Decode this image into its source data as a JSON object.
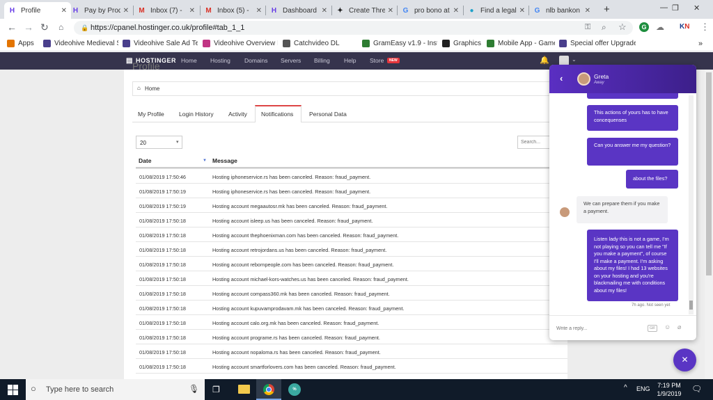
{
  "browser": {
    "tabs": [
      {
        "title": "Profile",
        "fav": "H",
        "color": "#673de6",
        "active": true
      },
      {
        "title": "Pay by Prod",
        "fav": "H",
        "color": "#673de6",
        "active": false
      },
      {
        "title": "Inbox (7) - ",
        "fav": "M",
        "color": "#d93025",
        "active": false
      },
      {
        "title": "Inbox (5) - ",
        "fav": "M",
        "color": "#d93025",
        "active": false
      },
      {
        "title": "Dashboard",
        "fav": "H",
        "color": "#673de6",
        "active": false
      },
      {
        "title": "Create Thre",
        "fav": "✦",
        "color": "#222222",
        "active": false
      },
      {
        "title": "pro bono at",
        "fav": "G",
        "color": "#4285f4",
        "active": false
      },
      {
        "title": "Find a legal",
        "fav": "●",
        "color": "#1da1c9",
        "active": false
      },
      {
        "title": "nlb bankon",
        "fav": "G",
        "color": "#4285f4",
        "active": false
      }
    ],
    "new_tab": "+",
    "window_controls": [
      "—",
      "❐",
      "✕"
    ],
    "url": "https://cpanel.hostinger.co.uk/profile#tab_1_1",
    "bookmarks": [
      {
        "label": "Apps",
        "color": "#e37400"
      },
      {
        "label": "Videohive Medieval S",
        "color": "#4a3f8c"
      },
      {
        "label": "Videohive Sale Ad Te",
        "color": "#4a3f8c"
      },
      {
        "label": "Videohive Overview I",
        "color": "#c13584"
      },
      {
        "label": "Catchvideo DL",
        "color": "#555555"
      },
      {
        "label": "GramEasy v1.9 - Insta",
        "color": "#2e7d32"
      },
      {
        "label": "Graphics",
        "color": "#222222"
      },
      {
        "label": "Mobile App - Game S",
        "color": "#2e7d32"
      },
      {
        "label": "Special offer Upgrade",
        "color": "#4a3f8c"
      }
    ],
    "more": "»"
  },
  "hostinger": {
    "logo": "HOSTINGER",
    "nav": [
      "Home",
      "Hosting",
      "Domains",
      "Servers",
      "Billing",
      "Help",
      "Store"
    ],
    "store_badge": "NEW"
  },
  "page": {
    "title": "Profile",
    "breadcrumb": "Home",
    "tabs": [
      "My Profile",
      "Login History",
      "Activity",
      "Notifications",
      "Personal Data"
    ],
    "active_tab": "Notifications",
    "page_size": "20",
    "search_placeholder": "Search...",
    "columns": {
      "date": "Date",
      "message": "Message"
    },
    "rows": [
      {
        "date": "01/08/2019 17:50:46",
        "message": "Hosting iphoneservice.rs has been canceled. Reason: fraud_payment."
      },
      {
        "date": "01/08/2019 17:50:19",
        "message": "Hosting iphoneservice.rs has been canceled. Reason: fraud_payment."
      },
      {
        "date": "01/08/2019 17:50:19",
        "message": "Hosting account megaautosr.mk has been canceled. Reason: fraud_payment."
      },
      {
        "date": "01/08/2019 17:50:18",
        "message": "Hosting account isleep.us has been canceled. Reason: fraud_payment."
      },
      {
        "date": "01/08/2019 17:50:18",
        "message": "Hosting account thephoenixman.com has been canceled. Reason: fraud_payment."
      },
      {
        "date": "01/08/2019 17:50:18",
        "message": "Hosting account retrojordans.us has been canceled. Reason: fraud_payment."
      },
      {
        "date": "01/08/2019 17:50:18",
        "message": "Hosting account rebornpeople.com has been canceled. Reason: fraud_payment."
      },
      {
        "date": "01/08/2019 17:50:18",
        "message": "Hosting account michael-kors-watches.us has been canceled. Reason: fraud_payment."
      },
      {
        "date": "01/08/2019 17:50:18",
        "message": "Hosting account compass360.mk has been canceled. Reason: fraud_payment."
      },
      {
        "date": "01/08/2019 17:50:18",
        "message": "Hosting account kupuvamprodavam.mk has been canceled. Reason: fraud_payment."
      },
      {
        "date": "01/08/2019 17:50:18",
        "message": "Hosting account calo.org.mk has been canceled. Reason: fraud_payment."
      },
      {
        "date": "01/08/2019 17:50:18",
        "message": "Hosting account programe.rs has been canceled. Reason: fraud_payment."
      },
      {
        "date": "01/08/2019 17:50:18",
        "message": "Hosting account nopaloma.rs has been canceled. Reason: fraud_payment."
      },
      {
        "date": "01/08/2019 17:50:18",
        "message": "Hosting account smartforlovers.com has been canceled. Reason: fraud_payment."
      }
    ]
  },
  "chat": {
    "agent_name": "Greta",
    "agent_status": "Away",
    "messages": [
      {
        "from": "user",
        "text": "This actions of yours has to have concequenses"
      },
      {
        "from": "user",
        "text": "Can you answer me my question?"
      },
      {
        "from": "user",
        "text": "about the files?"
      },
      {
        "from": "agent",
        "text": "We can prepare them if you make a payment."
      },
      {
        "from": "user",
        "text": "Listen lady this is not a game, I'm not playing so you can tell me \"If you make a payment\", of course I'll make a payment. I'm asking about my files! I had 13 websites on your hosting and you're blackmailing me with conditions about my files!"
      }
    ],
    "status_line": "7h ago. Not seen yet",
    "input_placeholder": "Write a reply...",
    "gif_label": "GIF",
    "close_icon": "✕"
  },
  "taskbar": {
    "search_placeholder": "Type here to search",
    "language": "ENG",
    "time": "7:19 PM",
    "date": "1/9/2019"
  }
}
